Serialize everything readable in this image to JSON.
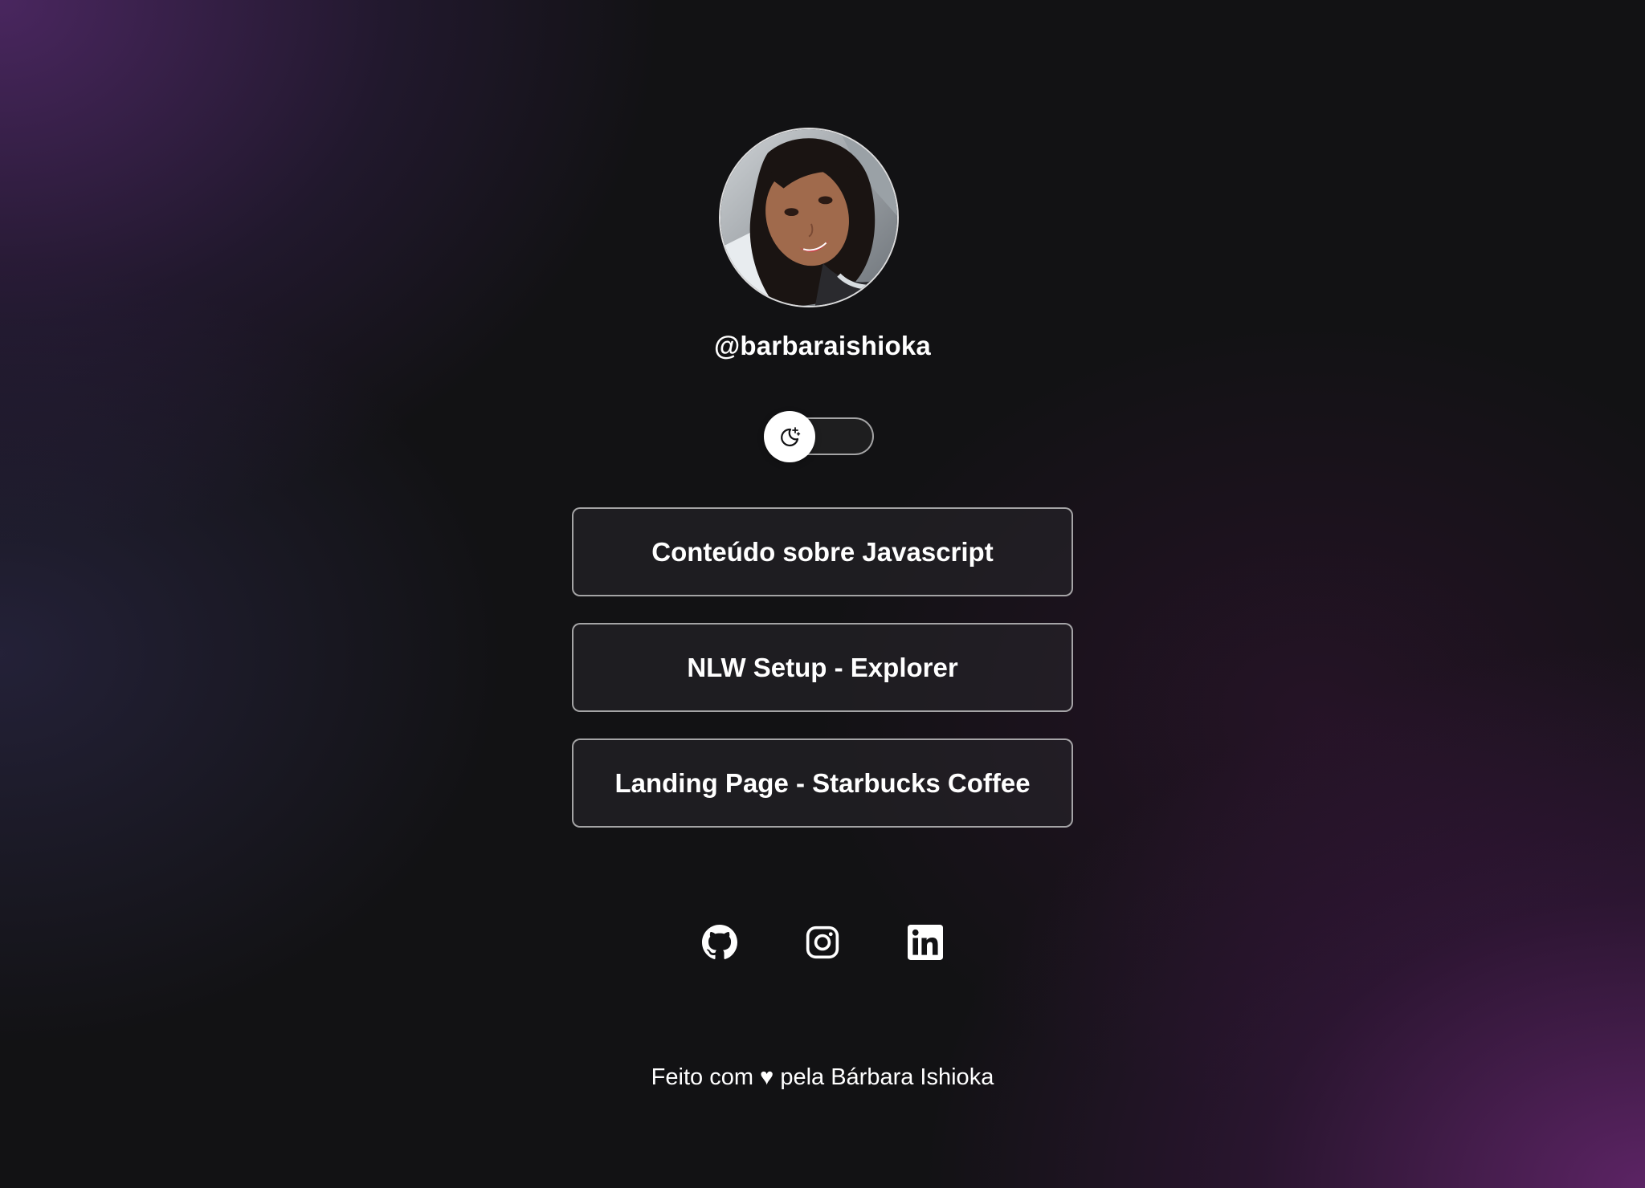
{
  "profile": {
    "username": "@barbaraishioka",
    "avatar_alt": "profile photo"
  },
  "theme_toggle": {
    "icon": "moon-stars-icon",
    "state": "dark"
  },
  "links": [
    {
      "label": "Conteúdo sobre Javascript"
    },
    {
      "label": "NLW Setup - Explorer"
    },
    {
      "label": "Landing Page - Starbucks Coffee"
    }
  ],
  "social": [
    {
      "icon": "github-icon"
    },
    {
      "icon": "instagram-icon"
    },
    {
      "icon": "linkedin-icon"
    }
  ],
  "footer": {
    "text": "Feito com ♥ pela Bárbara Ishioka"
  },
  "colors": {
    "background": "#121214",
    "accent_purple": "#5c2d78",
    "text": "#ffffff"
  }
}
